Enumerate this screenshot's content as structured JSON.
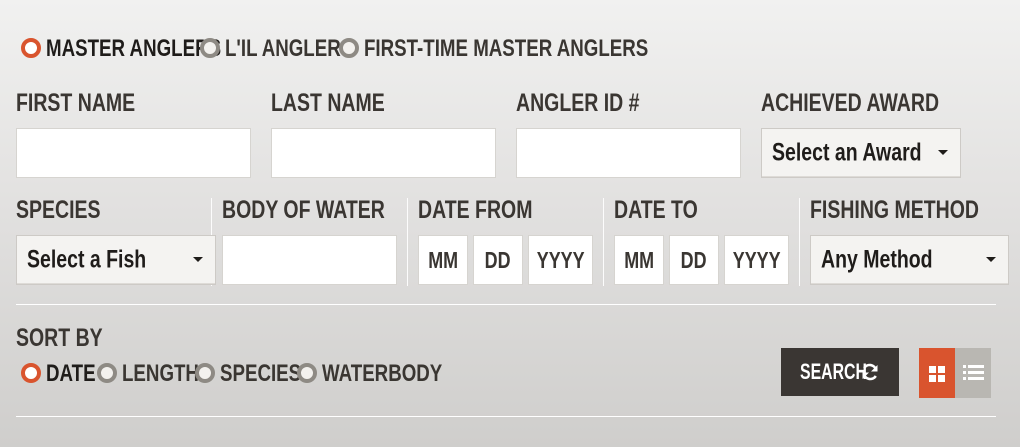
{
  "category_radios": [
    {
      "label": "MASTER ANGLERS",
      "selected": true
    },
    {
      "label": "L'IL ANGLERS",
      "selected": false
    },
    {
      "label": "FIRST-TIME MASTER ANGLERS",
      "selected": false
    }
  ],
  "fields": {
    "first_name": {
      "label": "FIRST NAME",
      "value": ""
    },
    "last_name": {
      "label": "LAST NAME",
      "value": ""
    },
    "angler_id": {
      "label": "ANGLER ID #",
      "value": ""
    },
    "achieved_award": {
      "label": "ACHIEVED AWARD",
      "selected": "Select an Award"
    },
    "species": {
      "label": "SPECIES",
      "selected": "Select a Fish"
    },
    "body_of_water": {
      "label": "BODY OF WATER",
      "value": ""
    },
    "date_from": {
      "label": "DATE FROM",
      "mm": "MM",
      "dd": "DD",
      "yyyy": "YYYY"
    },
    "date_to": {
      "label": "DATE TO",
      "mm": "MM",
      "dd": "DD",
      "yyyy": "YYYY"
    },
    "fishing_method": {
      "label": "FISHING METHOD",
      "selected": "Any Method"
    }
  },
  "sort": {
    "label": "SORT BY",
    "options": [
      {
        "label": "DATE",
        "selected": true
      },
      {
        "label": "LENGTH",
        "selected": false
      },
      {
        "label": "SPECIES",
        "selected": false
      },
      {
        "label": "WATERBODY",
        "selected": false
      }
    ]
  },
  "search_button": {
    "label": "SEARCH",
    "icon": "refresh-icon"
  },
  "view_toggle": {
    "active": "grid",
    "icons": [
      "grid-view-icon",
      "list-view-icon"
    ]
  },
  "colors": {
    "accent": "#d9542e",
    "dark_button": "#3a3633",
    "text": "#2e2b28"
  }
}
